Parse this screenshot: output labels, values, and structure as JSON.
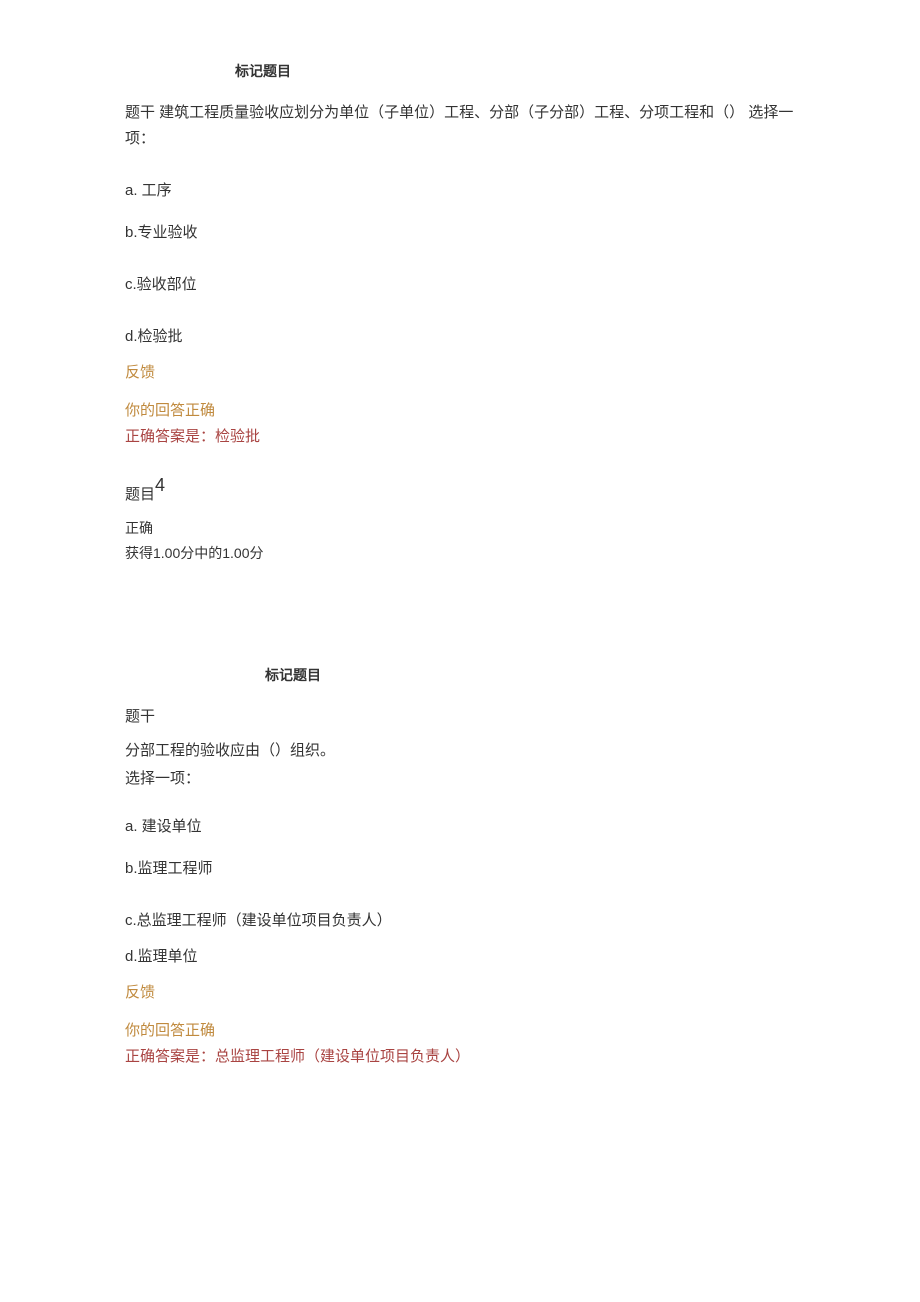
{
  "q3": {
    "mark_label": "标记题目",
    "stem": "题干  建筑工程质量验收应划分为单位（子单位）工程、分部（子分部）工程、分项工程和（）  选择一项：",
    "options": {
      "a": "a.      工序",
      "b": "b.专业验收",
      "c": "c.验收部位",
      "d": "d.检验批"
    },
    "feedback_header": "反馈",
    "feedback_result": "你的回答正确",
    "correct_answer": "正确答案是：检验批"
  },
  "q4": {
    "question_label": "题目",
    "question_number": "4",
    "status": "正确",
    "score": "获得1.00分中的1.00分",
    "mark_label": "标记题目",
    "stem_label": "题干",
    "stem_text": "分部工程的验收应由（）组织。",
    "select_prompt": "选择一项：",
    "options": {
      "a": "a.      建设单位",
      "b": "b.监理工程师",
      "c": "c.总监理工程师（建设单位项目负责人）",
      "d": "d.监理单位"
    },
    "feedback_header": "反馈",
    "feedback_result": "你的回答正确",
    "correct_answer": "正确答案是：总监理工程师（建设单位项目负责人）"
  }
}
